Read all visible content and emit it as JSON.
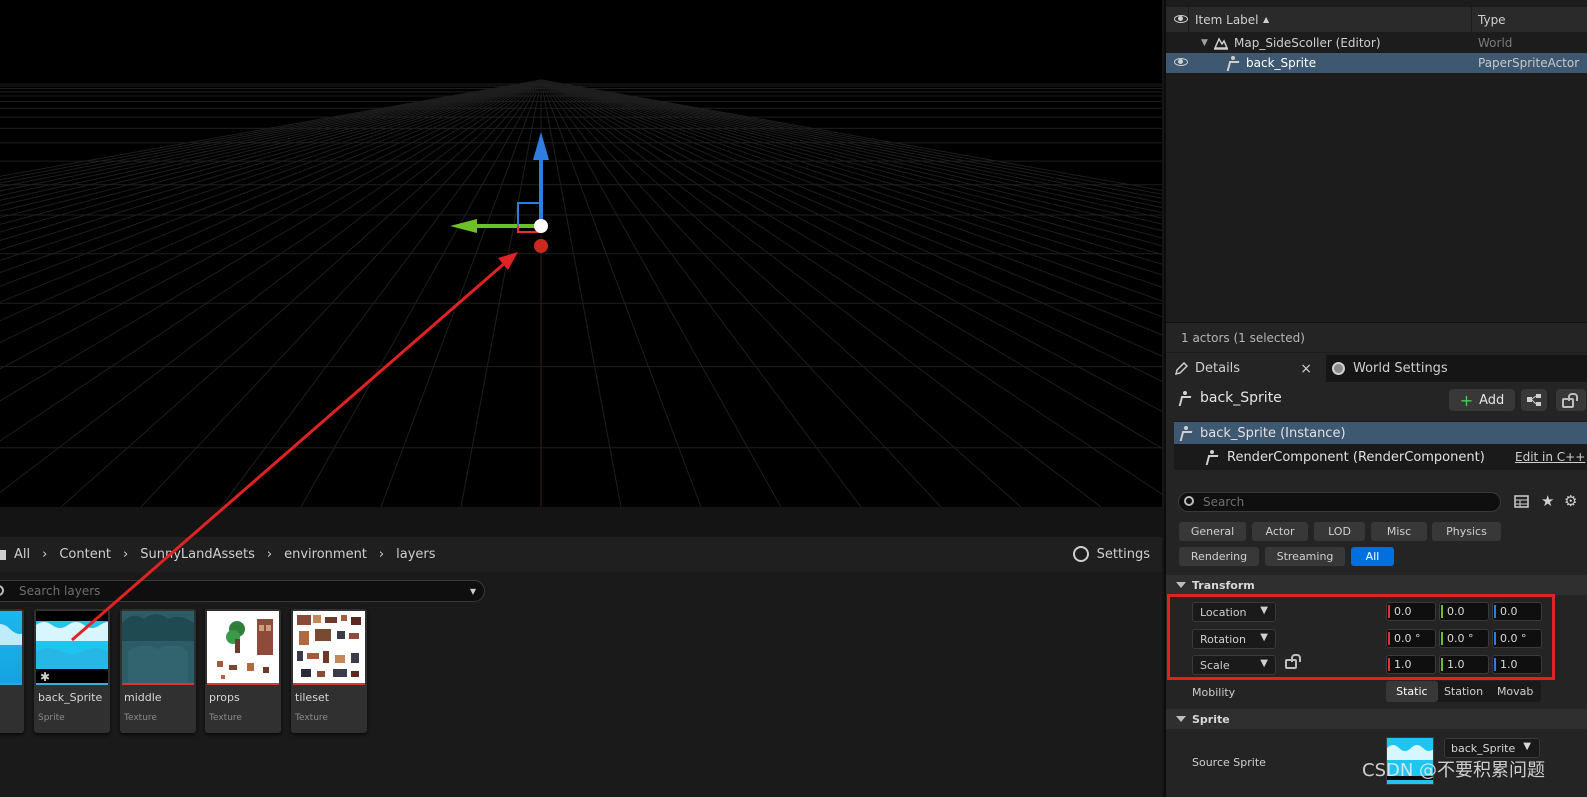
{
  "content_browser": {
    "breadcrumb": [
      "All",
      "Content",
      "SunnyLandAssets",
      "environment",
      "layers"
    ],
    "settings_label": "Settings",
    "search_placeholder": "Search layers",
    "assets": [
      {
        "name": "",
        "type": ""
      },
      {
        "name": "back_Sprite",
        "type": "Sprite"
      },
      {
        "name": "middle",
        "type": "Texture"
      },
      {
        "name": "props",
        "type": "Texture"
      },
      {
        "name": "tileset",
        "type": "Texture"
      }
    ]
  },
  "outliner": {
    "col_label": "Item Label",
    "sort_indicator": "▲",
    "col_type": "Type",
    "rows": [
      {
        "label": "Map_SideScoller (Editor)",
        "type": "World"
      },
      {
        "label": "back_Sprite",
        "type": "PaperSpriteActor"
      }
    ],
    "footer": "1 actors (1 selected)"
  },
  "tabs": {
    "details": "Details",
    "close": "×",
    "world_settings": "World Settings"
  },
  "details": {
    "actor_name": "back_Sprite",
    "add_label": "Add",
    "components": [
      {
        "label": "back_Sprite (Instance)"
      },
      {
        "label": "RenderComponent (RenderComponent)"
      }
    ],
    "edit_link": "Edit in C++",
    "search_placeholder": "Search",
    "filters": [
      "General",
      "Actor",
      "LOD",
      "Misc",
      "Physics",
      "Rendering",
      "Streaming",
      "All"
    ],
    "active_filter": "All",
    "transform_header": "Transform",
    "location": {
      "label": "Location",
      "x": "0.0",
      "y": "0.0",
      "z": "0.0"
    },
    "rotation": {
      "label": "Rotation",
      "x": "0.0 °",
      "y": "0.0 °",
      "z": "0.0 °"
    },
    "scale": {
      "label": "Scale",
      "x": "1.0",
      "y": "1.0",
      "z": "1.0"
    },
    "mobility_label": "Mobility",
    "mobility_options": [
      "Static",
      "Station",
      "Movab"
    ],
    "mobility_selected": "Static",
    "sprite_header": "Sprite",
    "source_sprite_label": "Source Sprite",
    "source_sprite_value": "back_Sprite"
  },
  "watermark": "CSDN @不要积累问题",
  "colors": {
    "selection": "#3d5870",
    "accent_blue": "#0070e0",
    "annotation_red": "#e02222",
    "axis_x": "#e23030",
    "axis_y": "#6cc02a",
    "axis_z": "#2f7de1"
  }
}
